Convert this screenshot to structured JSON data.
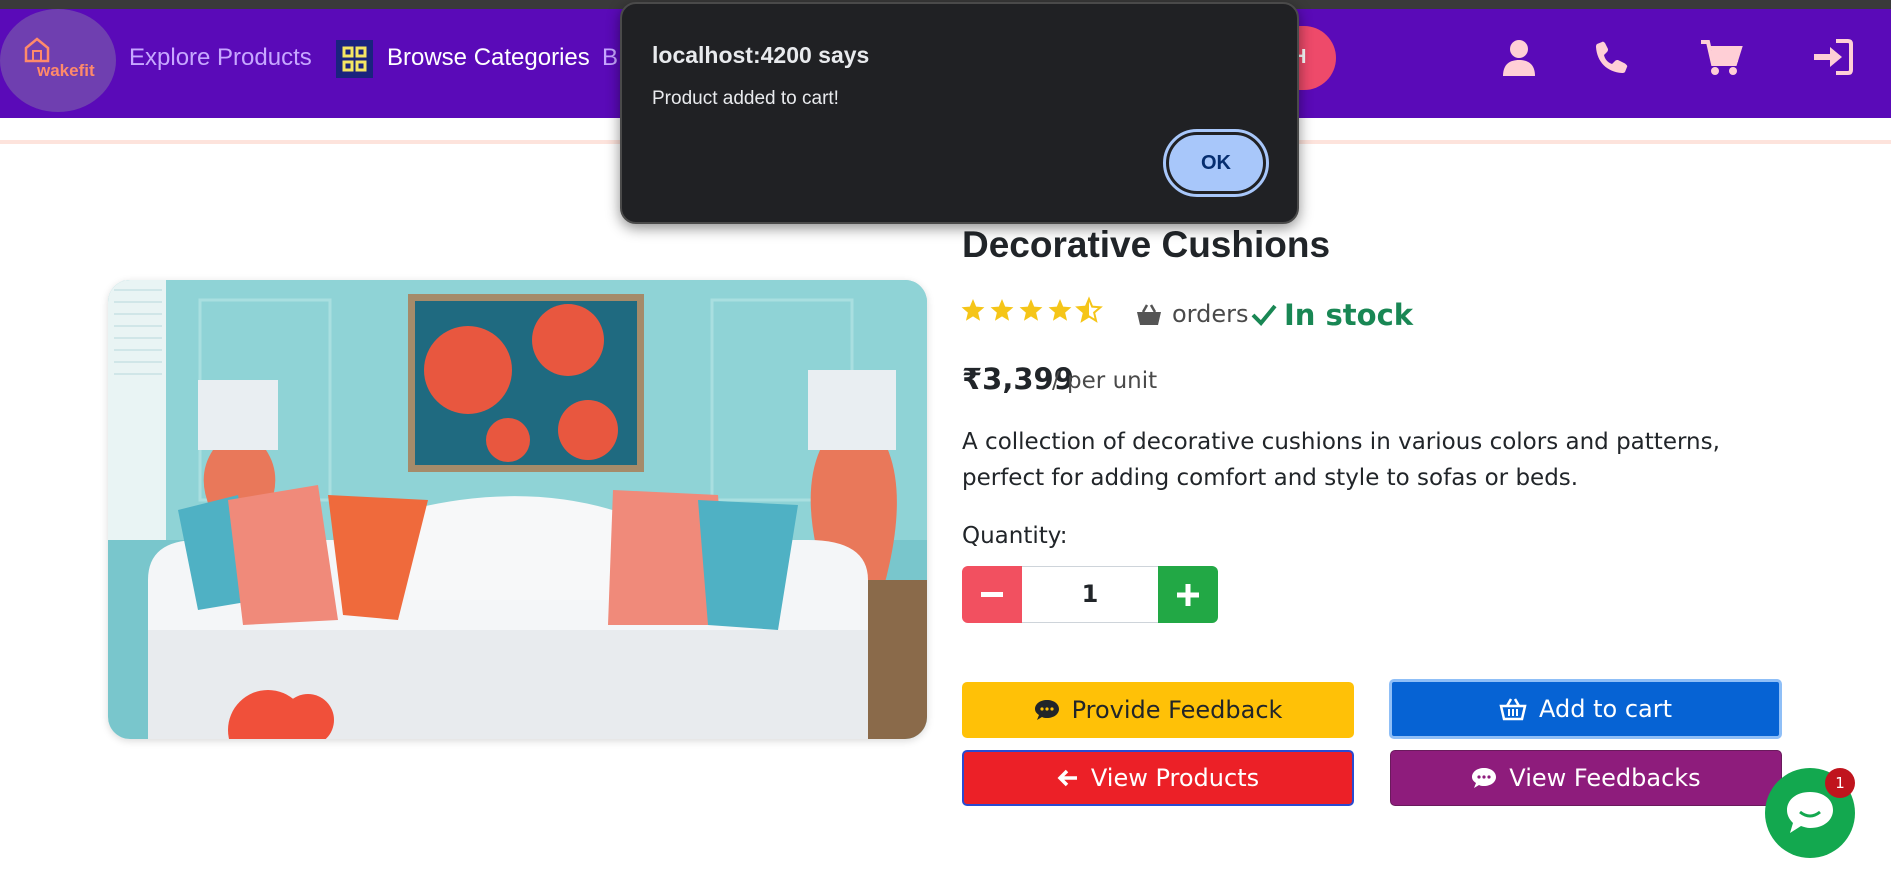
{
  "navbar": {
    "logo_text": "wakefit",
    "explore_label": "Explore Products",
    "categories_label": "Browse Categories",
    "truncated_label": "B",
    "search_button_text": "H"
  },
  "dialog": {
    "title": "localhost:4200 says",
    "message": "Product added to cart!",
    "ok_label": "OK"
  },
  "product": {
    "title": "Decorative Cushions",
    "rating": 4.5,
    "rating_max": 5,
    "orders_label": "orders",
    "stock_label": "In stock",
    "price": "₹3,399",
    "per_unit": "/ per unit",
    "description": "A collection of decorative cushions in various colors and patterns, perfect for adding comfort and style to sofas or beds.",
    "quantity_label": "Quantity:",
    "quantity_value": "1"
  },
  "actions": {
    "feedback_label": "Provide Feedback",
    "add_to_cart_label": "Add to cart",
    "view_products_label": "View Products",
    "view_feedbacks_label": "View Feedbacks"
  },
  "chat": {
    "badge_count": "1"
  },
  "colors": {
    "navbar": "#5a0ab8",
    "in_stock": "#198754",
    "feedback_btn": "#ffc107",
    "cart_btn": "#0663d4",
    "products_btn": "#ec2027",
    "viewfb_btn": "#8e1c7c",
    "chat": "#13a84f"
  }
}
